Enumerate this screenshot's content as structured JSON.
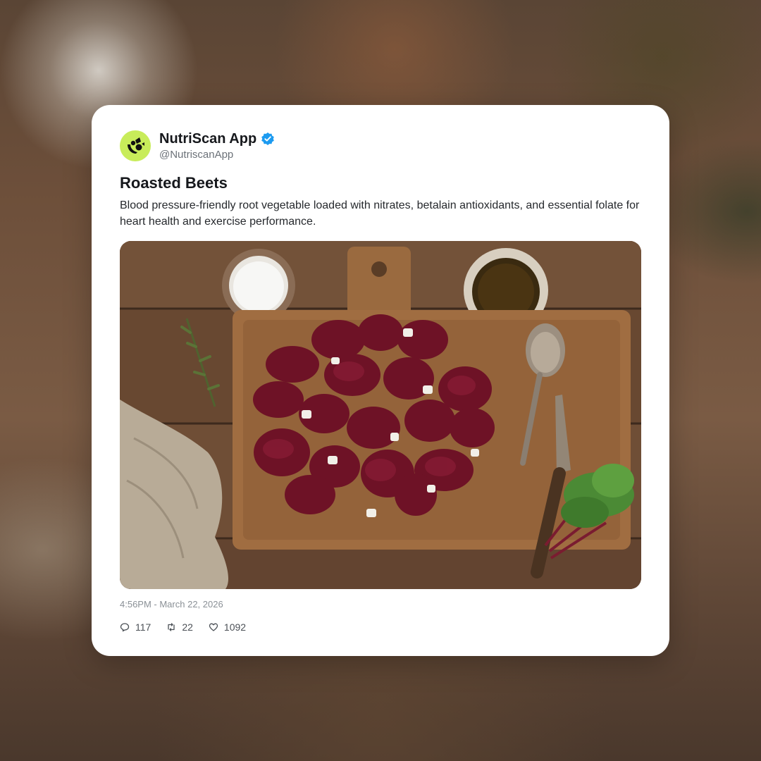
{
  "post": {
    "account_name": "NutriScan App",
    "handle": "@NutriscanApp",
    "verified": true,
    "title": "Roasted Beets",
    "description": "Blood pressure-friendly root vegetable loaded with nitrates, betalain antioxidants, and essential folate for heart health and exercise performance.",
    "image": {
      "subject": "roasted beet wedges with feta on a wooden cutting board",
      "icon": "food-photo"
    },
    "timestamp": "4:56PM - March 22, 2026",
    "stats": {
      "replies": "117",
      "reposts": "22",
      "likes": "1092"
    }
  },
  "colors": {
    "avatar_bg": "#c8ec5a",
    "verified_badge": "#1d9bf0",
    "card_bg": "#ffffff"
  },
  "icons": {
    "avatar": "nutriscan-logo-icon",
    "verified": "verified-badge-icon",
    "replies": "comment-icon",
    "reposts": "repost-icon",
    "likes": "heart-icon"
  }
}
